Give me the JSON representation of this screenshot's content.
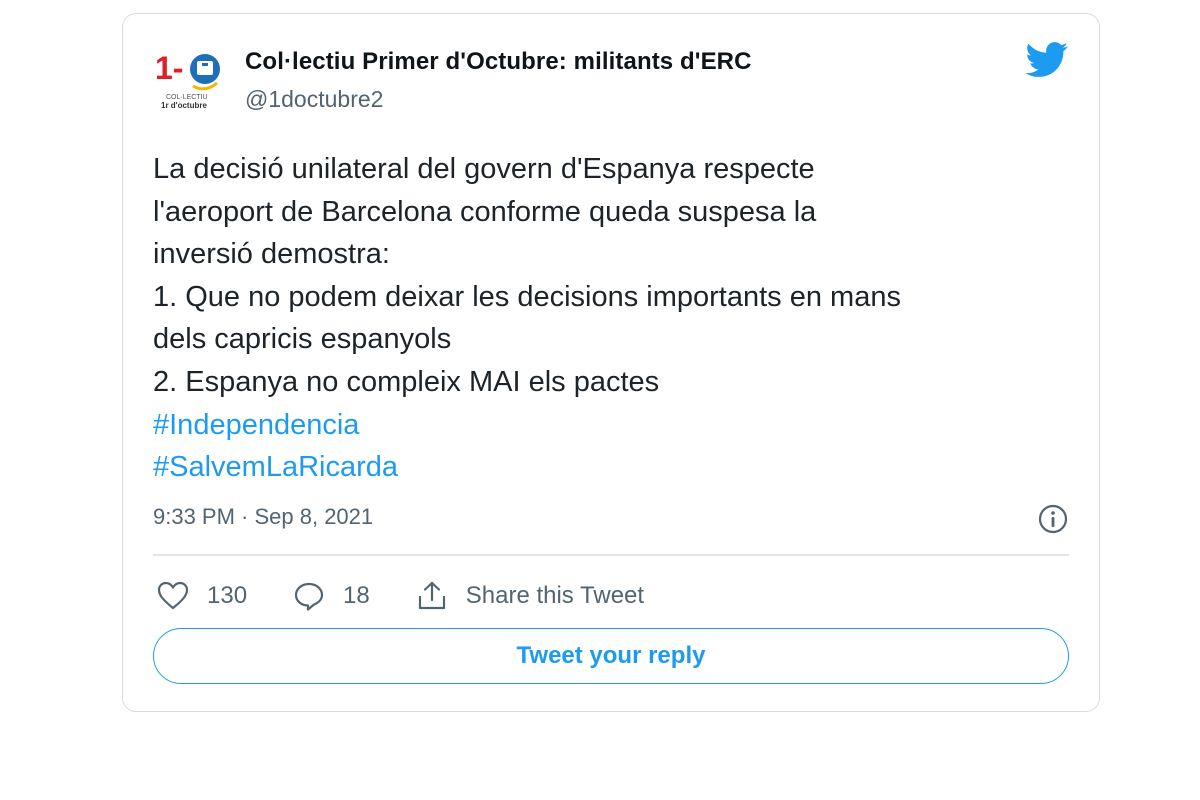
{
  "author": {
    "display_name": "Col·lectiu Primer d'Octubre: militants d'ERC",
    "handle": "@1doctubre2",
    "avatar": {
      "logo_text": "1-",
      "line1": "COL·LECTIU",
      "line2": "1r d'octubre"
    }
  },
  "tweet": {
    "lines": [
      "La decisió unilateral del govern d'Espanya respecte",
      "l'aeroport de Barcelona conforme queda suspesa la",
      "inversió demostra:",
      "1. Que no podem deixar les decisions importants en mans",
      "dels capricis espanyols",
      "2. Espanya no compleix MAI els pactes"
    ],
    "hashtags": [
      "#Independencia",
      "#SalvemLaRicarda"
    ],
    "timestamp": "9:33 PM · Sep 8, 2021"
  },
  "actions": {
    "likes": "130",
    "replies": "18",
    "share_label": "Share this Tweet"
  },
  "reply_button_label": "Tweet your reply",
  "icons": {
    "brand": "twitter-bird-icon",
    "info": "info-icon",
    "like": "heart-icon",
    "reply": "reply-bubble-icon",
    "share": "share-icon"
  },
  "colors": {
    "accent": "#1d9bf0",
    "text": "#0f1419",
    "secondary": "#536471",
    "logo_red": "#d8232a",
    "logo_blue": "#1e6fb8"
  }
}
